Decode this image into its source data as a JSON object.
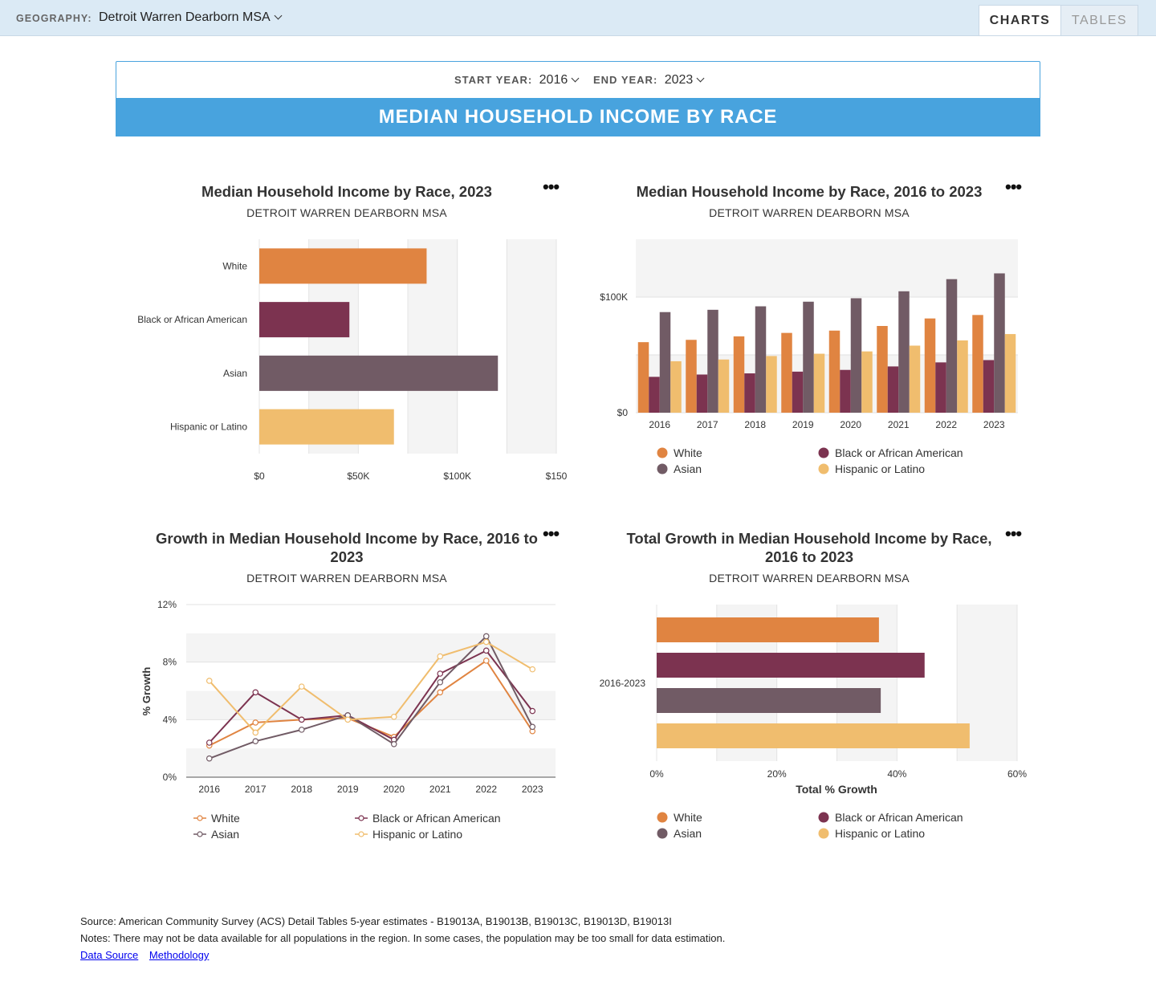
{
  "header": {
    "geography_label": "GEOGRAPHY:",
    "geography_value": "Detroit Warren Dearborn MSA",
    "tabs": [
      {
        "label": "CHARTS",
        "active": true
      },
      {
        "label": "TABLES",
        "active": false
      }
    ]
  },
  "controls": {
    "start_label": "START YEAR:",
    "start_value": "2016",
    "end_label": "END YEAR:",
    "end_value": "2023"
  },
  "banner": "MEDIAN HOUSEHOLD INCOME BY RACE",
  "menu_glyph": "•••",
  "colors": {
    "White": "#e08441",
    "Black or African American": "#7c3350",
    "Asian": "#715b65",
    "Hispanic or Latino": "#f0bd6e"
  },
  "charts": {
    "c1": {
      "title": "Median Household Income by Race, 2023",
      "subtitle": "DETROIT WARREN DEARBORN MSA"
    },
    "c2": {
      "title": "Median Household Income by Race, 2016 to 2023",
      "subtitle": "DETROIT WARREN DEARBORN MSA"
    },
    "c3": {
      "title": "Growth in Median Household Income by Race, 2016 to 2023",
      "subtitle": "DETROIT WARREN DEARBORN MSA"
    },
    "c4": {
      "title": "Total Growth in Median Household Income by Race, 2016 to 2023",
      "subtitle": "DETROIT WARREN DEARBORN MSA"
    }
  },
  "chart_data": [
    {
      "type": "bar",
      "orientation": "horizontal",
      "categories": [
        "White",
        "Black or African American",
        "Asian",
        "Hispanic or Latino"
      ],
      "values": [
        84500,
        45500,
        120500,
        68000
      ],
      "xlim": [
        0,
        150000
      ],
      "ticks": [
        "$0",
        "$50K",
        "$100K",
        "$150"
      ],
      "grid": true
    },
    {
      "type": "bar",
      "categories": [
        "2016",
        "2017",
        "2018",
        "2019",
        "2020",
        "2021",
        "2022",
        "2023"
      ],
      "series": [
        {
          "name": "White",
          "values": [
            61000,
            63000,
            66000,
            69000,
            71000,
            75000,
            81500,
            84500
          ]
        },
        {
          "name": "Black or African American",
          "values": [
            31000,
            33000,
            34000,
            35500,
            37000,
            40000,
            43500,
            45500
          ]
        },
        {
          "name": "Asian",
          "values": [
            87000,
            89000,
            92000,
            96000,
            99000,
            105000,
            115500,
            120500
          ]
        },
        {
          "name": "Hispanic or Latino",
          "values": [
            44500,
            46000,
            49000,
            51000,
            53000,
            58000,
            62500,
            68000
          ]
        }
      ],
      "ylim": [
        0,
        150000
      ],
      "ticks": [
        "$0",
        "$100K"
      ],
      "legend": "bottom"
    },
    {
      "type": "line",
      "x": [
        "2016",
        "2017",
        "2018",
        "2019",
        "2020",
        "2021",
        "2022",
        "2023"
      ],
      "series": [
        {
          "name": "White",
          "values": [
            2.2,
            3.8,
            4.0,
            4.1,
            2.8,
            5.9,
            8.1,
            3.2
          ]
        },
        {
          "name": "Black or African American",
          "values": [
            2.4,
            5.9,
            4.0,
            4.3,
            2.6,
            7.2,
            8.8,
            4.6
          ]
        },
        {
          "name": "Asian",
          "values": [
            1.3,
            2.5,
            3.3,
            4.3,
            2.3,
            6.6,
            9.8,
            3.5
          ]
        },
        {
          "name": "Hispanic or Latino",
          "values": [
            6.7,
            3.1,
            6.3,
            4.0,
            4.2,
            8.4,
            9.4,
            7.5
          ]
        }
      ],
      "ylim": [
        0,
        12
      ],
      "ticks": [
        "0%",
        "4%",
        "8%",
        "12%"
      ],
      "ylabel": "% Growth",
      "legend": "bottom"
    },
    {
      "type": "bar",
      "orientation": "horizontal",
      "categories": [
        "2016-2023"
      ],
      "series": [
        {
          "name": "White",
          "values": [
            37
          ]
        },
        {
          "name": "Black or African American",
          "values": [
            44.6
          ]
        },
        {
          "name": "Asian",
          "values": [
            37.3
          ]
        },
        {
          "name": "Hispanic or Latino",
          "values": [
            52.1
          ]
        }
      ],
      "xlim": [
        0,
        60
      ],
      "ticks": [
        "0%",
        "20%",
        "40%",
        "60%"
      ],
      "xlabel": "Total % Growth",
      "legend": "bottom"
    }
  ],
  "footer": {
    "source": "Source: American Community Survey (ACS) Detail Tables 5-year estimates - B19013A, B19013B, B19013C, B19013D, B19013I",
    "notes": "Notes: There may not be data available for all populations in the region. In some cases, the population may be too small for data estimation.",
    "links": [
      "Data Source",
      "Methodology"
    ]
  }
}
